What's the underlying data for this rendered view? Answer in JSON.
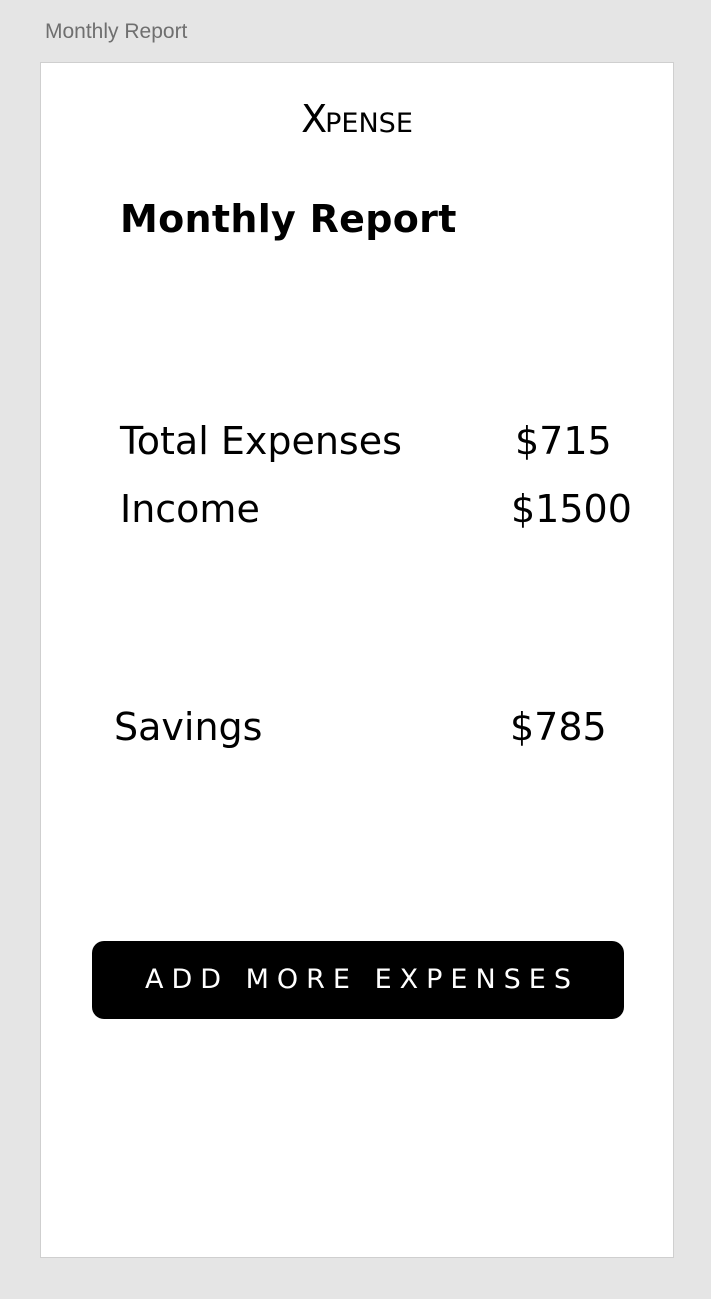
{
  "frame": {
    "label": "Monthly Report"
  },
  "brand": {
    "logo_x": "X",
    "logo_rest": "PENSE"
  },
  "page": {
    "title": "Monthly Report"
  },
  "summary": {
    "total_expenses": {
      "label": "Total Expenses",
      "value": "$715"
    },
    "income": {
      "label": "Income",
      "value": "$1500"
    },
    "savings": {
      "label": "Savings",
      "value": "$785"
    }
  },
  "actions": {
    "add_more_label": "ADD MORE EXPENSES"
  },
  "colors": {
    "background": "#e5e5e5",
    "card": "#ffffff",
    "text": "#000000",
    "button": "#000000",
    "button_text": "#ffffff"
  }
}
